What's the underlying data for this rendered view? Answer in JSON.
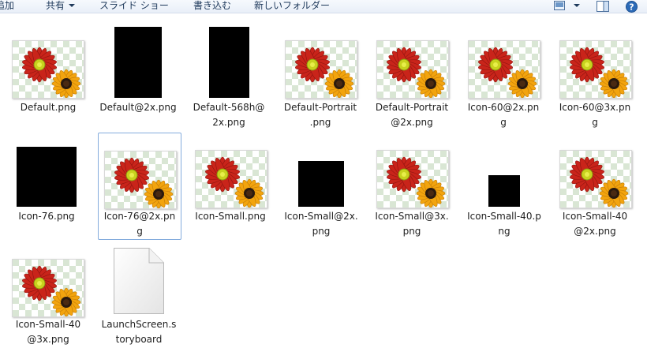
{
  "toolbar": {
    "add_fragment": "追加",
    "share": "共有",
    "slideshow": "スライド ショー",
    "burn": "書き込む",
    "new_folder": "新しいフォルダー",
    "view_icon": "view-options-icon",
    "pane_icon": "preview-pane-icon",
    "help_icon": "help-icon"
  },
  "files": [
    {
      "name1": "Default.png",
      "name2": "",
      "kind": "flower"
    },
    {
      "name1": "Default@2x.png",
      "name2": "",
      "kind": "black-tall"
    },
    {
      "name1": "Default-568h@",
      "name2": "2x.png",
      "kind": "black-tall"
    },
    {
      "name1": "Default-Portrait",
      "name2": ".png",
      "kind": "flower"
    },
    {
      "name1": "Default-Portrait",
      "name2": "@2x.png",
      "kind": "flower"
    },
    {
      "name1": "Icon-60@2x.pn",
      "name2": "g",
      "kind": "flower"
    },
    {
      "name1": "Icon-60@3x.pn",
      "name2": "g",
      "kind": "flower"
    },
    {
      "name1": "Icon-76.png",
      "name2": "",
      "kind": "black-square-large"
    },
    {
      "name1": "Icon-76@2x.pn",
      "name2": "g",
      "kind": "flower",
      "selected": true
    },
    {
      "name1": "Icon-Small.png",
      "name2": "",
      "kind": "flower"
    },
    {
      "name1": "Icon-Small@2x.",
      "name2": "png",
      "kind": "black-square-medium"
    },
    {
      "name1": "Icon-Small@3x.",
      "name2": "png",
      "kind": "flower"
    },
    {
      "name1": "Icon-Small-40.p",
      "name2": "ng",
      "kind": "black-square-small"
    },
    {
      "name1": "Icon-Small-40",
      "name2": "@2x.png",
      "kind": "flower"
    },
    {
      "name1": "Icon-Small-40",
      "name2": "@3x.png",
      "kind": "flower"
    },
    {
      "name1": "LaunchScreen.s",
      "name2": "toryboard",
      "kind": "document"
    }
  ]
}
